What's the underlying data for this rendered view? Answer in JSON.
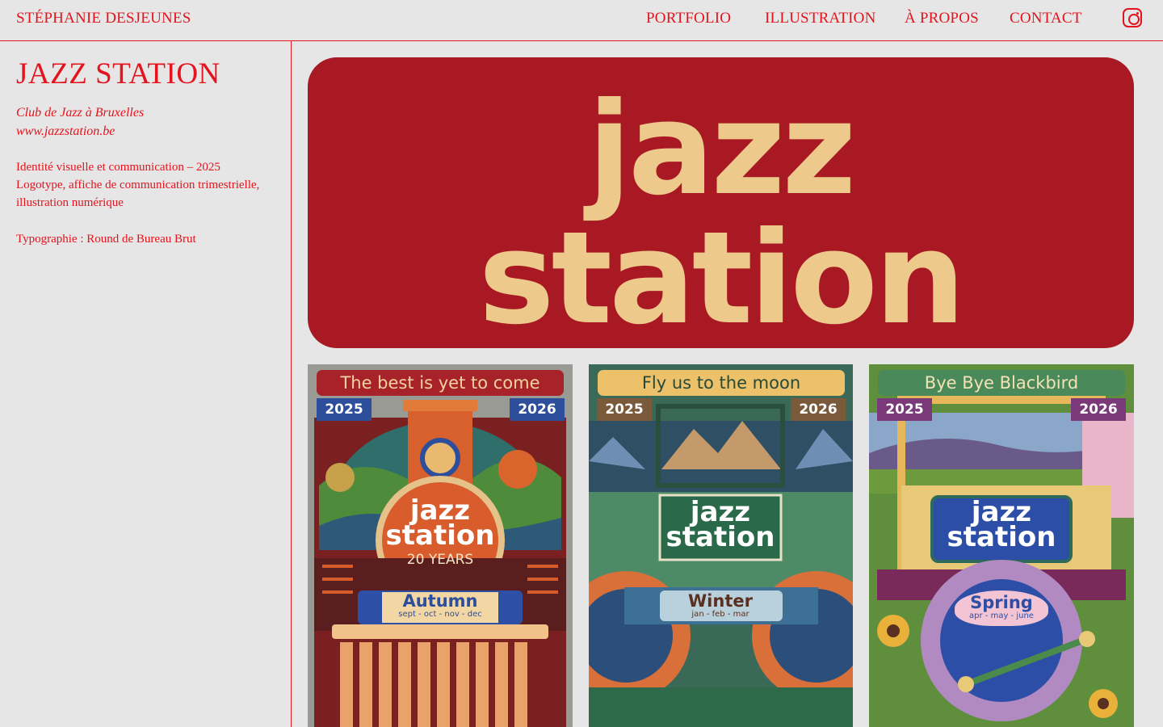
{
  "header": {
    "site_name": "STÉPHANIE DESJEUNES",
    "nav": [
      "PORTFOLIO",
      "ILLUSTRATION",
      "À PROPOS",
      "CONTACT"
    ],
    "instagram_icon": "instagram-icon"
  },
  "project": {
    "title": "JAZZ STATION",
    "subtitle": "Club de Jazz à Bruxelles",
    "link": "www.jazzstation.be",
    "description_line1": "Identité visuelle et communication – 2025",
    "description_line2": "Logotype, affiche de communication trimestrielle, illustration numérique",
    "typography": "Typographie : Round de Bureau Brut"
  },
  "hero": {
    "logo_line1": "jazz",
    "logo_line2": "station",
    "colors": {
      "background": "#a81923",
      "logo": "#edc98b"
    }
  },
  "posters": [
    {
      "banner": "The best is yet to come",
      "year_left": "2025",
      "year_right": "2026",
      "logo_line1": "jazz",
      "logo_line2": "station",
      "extra": "20 YEARS",
      "season": "Autumn",
      "months": "sept - oct - nov - dec"
    },
    {
      "banner": "Fly us to the moon",
      "year_left": "2025",
      "year_right": "2026",
      "logo_line1": "jazz",
      "logo_line2": "station",
      "season": "Winter",
      "months": "jan - feb - mar"
    },
    {
      "banner": "Bye Bye Blackbird",
      "year_left": "2025",
      "year_right": "2026",
      "logo_line1": "jazz",
      "logo_line2": "station",
      "season": "Spring",
      "months": "apr - may - june"
    }
  ],
  "colors": {
    "accent": "#e3141e",
    "page_bg": "#e6e6e6"
  }
}
